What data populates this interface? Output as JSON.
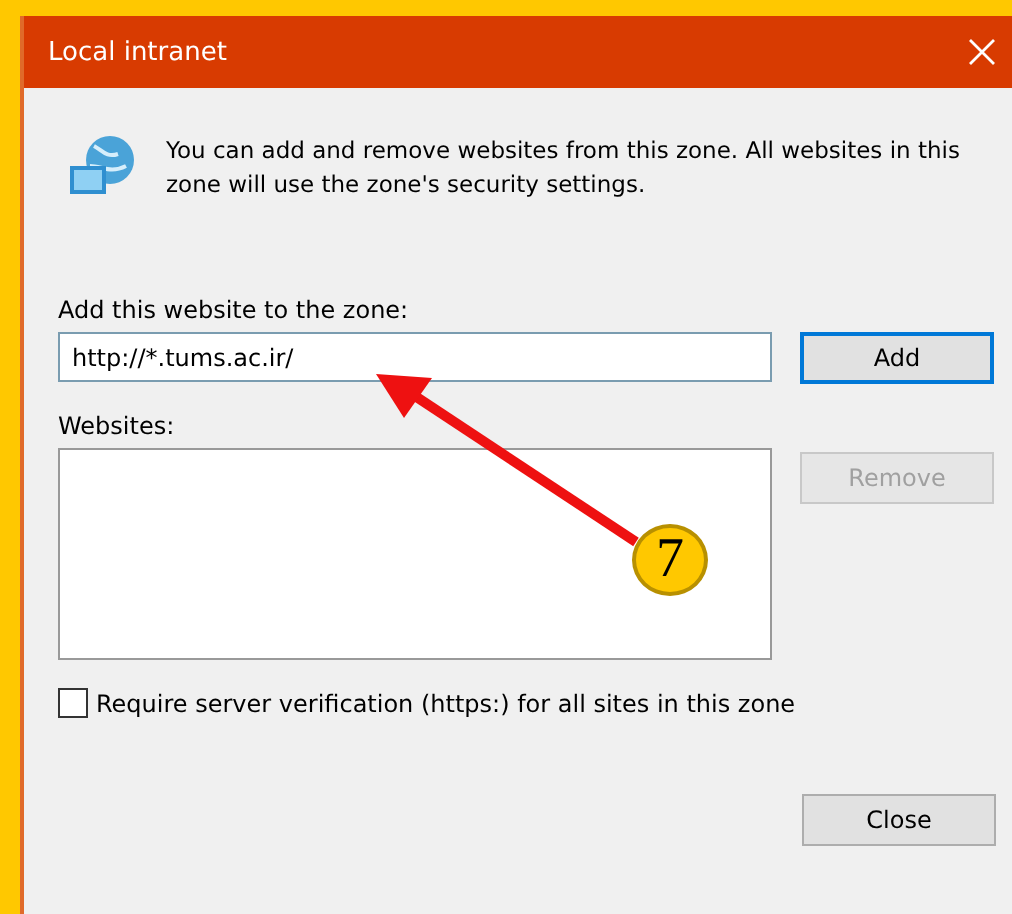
{
  "window": {
    "title": "Local intranet"
  },
  "description": "You can add and remove websites from this zone. All websites in this zone will use the zone's security settings.",
  "add_field": {
    "label": "Add this website to the zone:",
    "value": "http://*.tums.ac.ir/"
  },
  "add_button": {
    "label": "Add",
    "disabled": false
  },
  "websites": {
    "label": "Websites:"
  },
  "remove_button": {
    "label": "Remove",
    "disabled": true
  },
  "require_https": {
    "label": "Require server verification (https:) for all sites in this zone",
    "checked": false
  },
  "close_button": {
    "label": "Close",
    "disabled": false
  },
  "annotation": {
    "number": "7"
  }
}
